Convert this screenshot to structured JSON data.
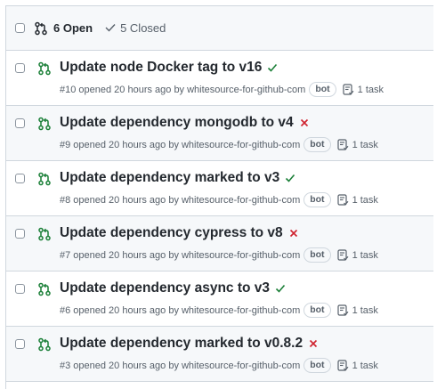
{
  "header": {
    "open_label": "6 Open",
    "closed_label": "5 Closed"
  },
  "colors": {
    "open_green": "#1a7f37",
    "fail_red": "#cf222e",
    "text": "#24292f",
    "muted": "#57606a",
    "border": "#d0d7de"
  },
  "pull_requests": [
    {
      "title": "Update node Docker tag to v16",
      "status": "success",
      "meta": "#10 opened 20 hours ago by",
      "author": "whitesource-for-github-com",
      "badge": "bot",
      "tasks": "1 task"
    },
    {
      "title": "Update dependency mongodb to v4",
      "status": "failure",
      "meta": "#9 opened 20 hours ago by",
      "author": "whitesource-for-github-com",
      "badge": "bot",
      "tasks": "1 task"
    },
    {
      "title": "Update dependency marked to v3",
      "status": "success",
      "meta": "#8 opened 20 hours ago by",
      "author": "whitesource-for-github-com",
      "badge": "bot",
      "tasks": "1 task"
    },
    {
      "title": "Update dependency cypress to v8",
      "status": "failure",
      "meta": "#7 opened 20 hours ago by",
      "author": "whitesource-for-github-com",
      "badge": "bot",
      "tasks": "1 task"
    },
    {
      "title": "Update dependency async to v3",
      "status": "success",
      "meta": "#6 opened 20 hours ago by",
      "author": "whitesource-for-github-com",
      "badge": "bot",
      "tasks": "1 task"
    },
    {
      "title": "Update dependency marked to v0.8.2",
      "status": "failure",
      "meta": "#3 opened 20 hours ago by",
      "author": "whitesource-for-github-com",
      "badge": "bot",
      "tasks": "1 task"
    }
  ]
}
